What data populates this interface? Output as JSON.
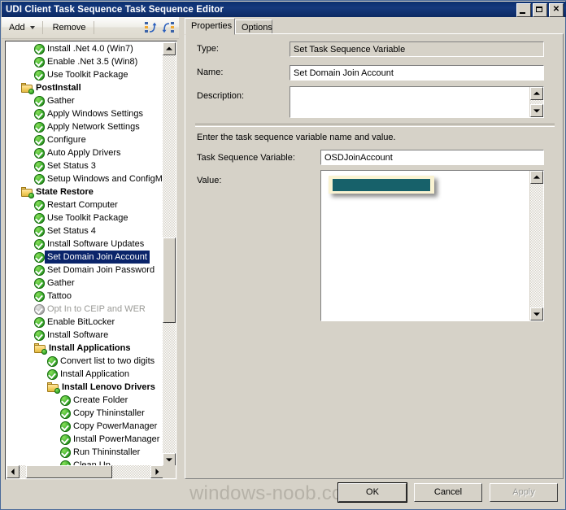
{
  "window": {
    "title": "UDI Client Task Sequence Task Sequence Editor",
    "buttons": {
      "minimize": "minimize-icon",
      "maximize": "maximize-icon",
      "close": "✕"
    }
  },
  "toolbar": {
    "add_label": "Add",
    "remove_label": "Remove",
    "icon_move_up": "move-step-up-icon",
    "icon_move_down": "move-step-down-icon"
  },
  "tree": {
    "items": [
      {
        "label": "Install .Net 4.0 (Win7)",
        "type": "step",
        "indent": 2,
        "state": "on"
      },
      {
        "label": "Enable .Net 3.5 (Win8)",
        "type": "step",
        "indent": 2,
        "state": "on"
      },
      {
        "label": "Use Toolkit Package",
        "type": "step",
        "indent": 2,
        "state": "on"
      },
      {
        "label": "PostInstall",
        "type": "folder",
        "indent": 1,
        "state": "on"
      },
      {
        "label": "Gather",
        "type": "step",
        "indent": 2,
        "state": "on"
      },
      {
        "label": "Apply Windows Settings",
        "type": "step",
        "indent": 2,
        "state": "on"
      },
      {
        "label": "Apply Network Settings",
        "type": "step",
        "indent": 2,
        "state": "on"
      },
      {
        "label": "Configure",
        "type": "step",
        "indent": 2,
        "state": "on"
      },
      {
        "label": "Auto Apply Drivers",
        "type": "step",
        "indent": 2,
        "state": "on"
      },
      {
        "label": "Set Status 3",
        "type": "step",
        "indent": 2,
        "state": "on"
      },
      {
        "label": "Setup Windows and ConfigMgr",
        "type": "step",
        "indent": 2,
        "state": "on"
      },
      {
        "label": "State Restore",
        "type": "folder",
        "indent": 1,
        "state": "on"
      },
      {
        "label": "Restart Computer",
        "type": "step",
        "indent": 2,
        "state": "on"
      },
      {
        "label": "Use Toolkit Package",
        "type": "step",
        "indent": 2,
        "state": "on"
      },
      {
        "label": "Set Status 4",
        "type": "step",
        "indent": 2,
        "state": "on"
      },
      {
        "label": "Install Software Updates",
        "type": "step",
        "indent": 2,
        "state": "on"
      },
      {
        "label": "Set Domain Join Account",
        "type": "step",
        "indent": 2,
        "state": "on",
        "selected": true
      },
      {
        "label": "Set Domain Join Password",
        "type": "step",
        "indent": 2,
        "state": "on"
      },
      {
        "label": "Gather",
        "type": "step",
        "indent": 2,
        "state": "on"
      },
      {
        "label": "Tattoo",
        "type": "step",
        "indent": 2,
        "state": "on"
      },
      {
        "label": "Opt In to CEIP and WER",
        "type": "step",
        "indent": 2,
        "state": "off",
        "disabled": true
      },
      {
        "label": "Enable BitLocker",
        "type": "step",
        "indent": 2,
        "state": "on"
      },
      {
        "label": "Install Software",
        "type": "step",
        "indent": 2,
        "state": "on"
      },
      {
        "label": "Install Applications",
        "type": "folder",
        "indent": 2,
        "state": "on"
      },
      {
        "label": "Convert list to two digits",
        "type": "step",
        "indent": 3,
        "state": "on"
      },
      {
        "label": "Install Application",
        "type": "step",
        "indent": 3,
        "state": "on"
      },
      {
        "label": "Install Lenovo Drivers",
        "type": "folder",
        "indent": 3,
        "state": "on"
      },
      {
        "label": "Create Folder",
        "type": "step",
        "indent": 4,
        "state": "on"
      },
      {
        "label": "Copy Thininstaller",
        "type": "step",
        "indent": 4,
        "state": "on"
      },
      {
        "label": "Copy PowerManager",
        "type": "step",
        "indent": 4,
        "state": "on"
      },
      {
        "label": "Install PowerManager",
        "type": "step",
        "indent": 4,
        "state": "on"
      },
      {
        "label": "Run Thininstaller",
        "type": "step",
        "indent": 4,
        "state": "on"
      },
      {
        "label": "Clean Up",
        "type": "step",
        "indent": 4,
        "state": "on"
      }
    ]
  },
  "tabs": [
    {
      "label": "Properties",
      "active": true
    },
    {
      "label": "Options",
      "active": false
    }
  ],
  "properties": {
    "type_label": "Type:",
    "type_value": "Set Task Sequence Variable",
    "name_label": "Name:",
    "name_value": "Set Domain Join Account",
    "description_label": "Description:",
    "description_value": "",
    "instruction": "Enter the task sequence variable name and value.",
    "variable_label": "Task Sequence Variable:",
    "variable_value": "OSDJoinAccount",
    "value_label": "Value:",
    "value_value": "",
    "redaction_color": "#17616a",
    "highlight_color": "#faf3d2"
  },
  "footer": {
    "watermark": "windows-noob.com",
    "ok_label": "OK",
    "cancel_label": "Cancel",
    "apply_label": "Apply",
    "apply_disabled": true
  }
}
